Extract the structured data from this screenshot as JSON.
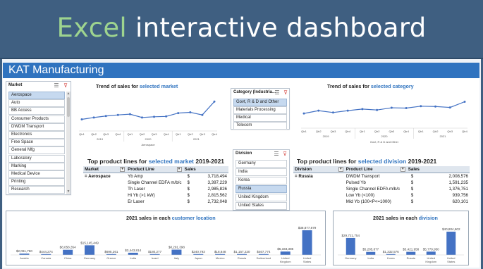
{
  "banner": {
    "title_accent": "Excel",
    "title_rest": "interactive dashboard"
  },
  "section": {
    "title": "KAT Manufacturing"
  },
  "market_slicer": {
    "title": "Market",
    "items": [
      "Aerospace",
      "Auto",
      "BB Access",
      "Consumer Products",
      "DWDM Transport",
      "Electronics",
      "Free Space",
      "General Mfg",
      "Laboratory",
      "Marking",
      "Medical Device",
      "Printing",
      "Research"
    ],
    "selected": "Aerospace"
  },
  "category_slicer": {
    "title": "Category (Industria...",
    "items": [
      "Govt, R & D and Other",
      "Materials Processing",
      "Medical",
      "Telecom"
    ],
    "selected": "Govt, R & D and Other"
  },
  "division_slicer": {
    "title": "Division",
    "items": [
      "Germany",
      "India",
      "Korea",
      "Russia",
      "United Kingdom",
      "United States"
    ],
    "selected": "Russia"
  },
  "market_trend": {
    "title_prefix": "Trend of sales for",
    "title_highlight": "selected market",
    "quarters": [
      "Qtr1",
      "Qtr2",
      "Qtr3",
      "Qtr4",
      "Qtr1",
      "Qtr2",
      "Qtr3",
      "Qtr4",
      "Qtr1",
      "Qtr2",
      "Qtr3",
      "Qtr4"
    ],
    "years": [
      "2019",
      "2020",
      "2021"
    ],
    "subtitle": "Aerospace"
  },
  "category_trend": {
    "title_prefix": "Trend of sales for",
    "title_highlight": "selected category",
    "quarters": [
      "Qtr1",
      "Qtr2",
      "Qtr3",
      "Qtr4",
      "Qtr1",
      "Qtr2",
      "Qtr3",
      "Qtr4",
      "Qtr1",
      "Qtr2",
      "Qtr3",
      "Qtr4"
    ],
    "years": [
      "2019",
      "2020",
      "2021"
    ],
    "subtitle": "Govt, R & D and Other"
  },
  "market_table": {
    "title_prefix": "Top product lines for",
    "title_highlight": "selected market",
    "title_suffix": "2019-2021",
    "headers": [
      "Market",
      "Product Line",
      "Sales"
    ],
    "group": "Aerospace",
    "rows": [
      {
        "product": "Yb Amp",
        "sales": "3,718,494"
      },
      {
        "product": "Single Channel EDFA m/b/c",
        "sales": "3,397,229"
      },
      {
        "product": "Th Laser",
        "sales": "2,985,826"
      },
      {
        "product": "Hi Yb (>1 kW)",
        "sales": "2,815,562"
      },
      {
        "product": "Er Laser",
        "sales": "2,732,048"
      }
    ],
    "currency": "$"
  },
  "division_table": {
    "title_prefix": "Top product lines for",
    "title_highlight": "selected division",
    "title_suffix": "2019-2021",
    "headers": [
      "Division",
      "Product Line",
      "Sales"
    ],
    "group": "Russia",
    "rows": [
      {
        "product": "DWDM Transport",
        "sales": "2,008,576"
      },
      {
        "product": "Pulsed Yb",
        "sales": "1,591,235"
      },
      {
        "product": "Single Channel EDFA m/b/c",
        "sales": "1,376,751"
      },
      {
        "product": "Low Yb (<100)",
        "sales": "939,756"
      },
      {
        "product": "Mid Yb (100<P<=1000)",
        "sales": "620,101"
      }
    ],
    "currency": "$"
  },
  "location_chart": {
    "title_prefix": "2021 sales in each",
    "title_highlight": "customer location"
  },
  "division_chart": {
    "title_prefix": "2021 sales in each",
    "title_highlight": "division"
  },
  "chart_data": [
    {
      "type": "line",
      "title": "Trend of sales for selected market",
      "x": [
        "2019 Qtr1",
        "2019 Qtr2",
        "2019 Qtr3",
        "2019 Qtr4",
        "2020 Qtr1",
        "2020 Qtr2",
        "2020 Qtr3",
        "2020 Qtr4",
        "2021 Qtr1",
        "2021 Qtr2",
        "2021 Qtr3",
        "2021 Qtr4"
      ],
      "series": [
        {
          "name": "Aerospace",
          "values": [
            2.0,
            2.5,
            2.9,
            3.2,
            3.4,
            2.5,
            2.7,
            2.8,
            3.7,
            3.9,
            3.2,
            6.8
          ]
        }
      ],
      "ylim": [
        0,
        8
      ],
      "grid": false
    },
    {
      "type": "line",
      "title": "Trend of sales for selected category",
      "x": [
        "2019 Qtr1",
        "2019 Qtr2",
        "2019 Qtr3",
        "2019 Qtr4",
        "2020 Qtr1",
        "2020 Qtr2",
        "2020 Qtr3",
        "2020 Qtr4",
        "2021 Qtr1",
        "2021 Qtr2",
        "2021 Qtr3",
        "2021 Qtr4"
      ],
      "series": [
        {
          "name": "Govt, R & D and Other",
          "values": [
            3.3,
            4.2,
            3.6,
            4.2,
            4.7,
            4.4,
            5.1,
            5.0,
            5.6,
            5.5,
            5.2,
            7.0
          ]
        }
      ],
      "ylim": [
        0,
        8
      ],
      "grid": false
    },
    {
      "type": "bar",
      "title": "2021 sales in each customer location",
      "categories": [
        "Austria",
        "Canada",
        "China",
        "Germany",
        "Greece",
        "India",
        "Israel",
        "Italy",
        "Japan",
        "Mexico",
        "Russia",
        "Switzerland",
        "United Kingdom",
        "United States"
      ],
      "values": [
        2061760,
        444274,
        8058354,
        15145449,
        695261,
        3443814,
        180277,
        8291398,
        240793,
        18848,
        1157220,
        467774,
        5333385,
        38877879
      ],
      "labels": [
        "$2,061,760",
        "$444,274",
        "$8,058,354",
        "$15,145,449",
        "$695,261",
        "$3,443,814",
        "$180,277",
        "$8,291,398",
        "$240,793",
        "$18,848",
        "$1,157,220",
        "$467,774",
        "$5,333,385",
        "$38,877,879"
      ],
      "ylim": [
        0,
        40000000
      ]
    },
    {
      "type": "bar",
      "title": "2021 sales in each division",
      "categories": [
        "Germany",
        "India",
        "Korea",
        "Russia",
        "United Kingdom",
        "United States"
      ],
      "values": [
        29721754,
        5285877,
        1332576,
        5421958,
        5779950,
        40804602
      ],
      "labels": [
        "$29,721,754",
        "$5,285,877",
        "$1,332,576",
        "$5,421,958",
        "$5,779,950",
        "$40,804,602"
      ],
      "ylim": [
        0,
        42000000
      ]
    }
  ],
  "colors": {
    "banner": "#3f5f81",
    "accent_green": "#9ed48f",
    "section_bar": "#2f73bf",
    "series": "#4472c4",
    "selected": "#c6d9ef"
  },
  "icons": {
    "multi_select": "multi-select-icon",
    "clear_filter": "clear-filter-icon",
    "dropdown": "dropdown-arrow-icon"
  }
}
